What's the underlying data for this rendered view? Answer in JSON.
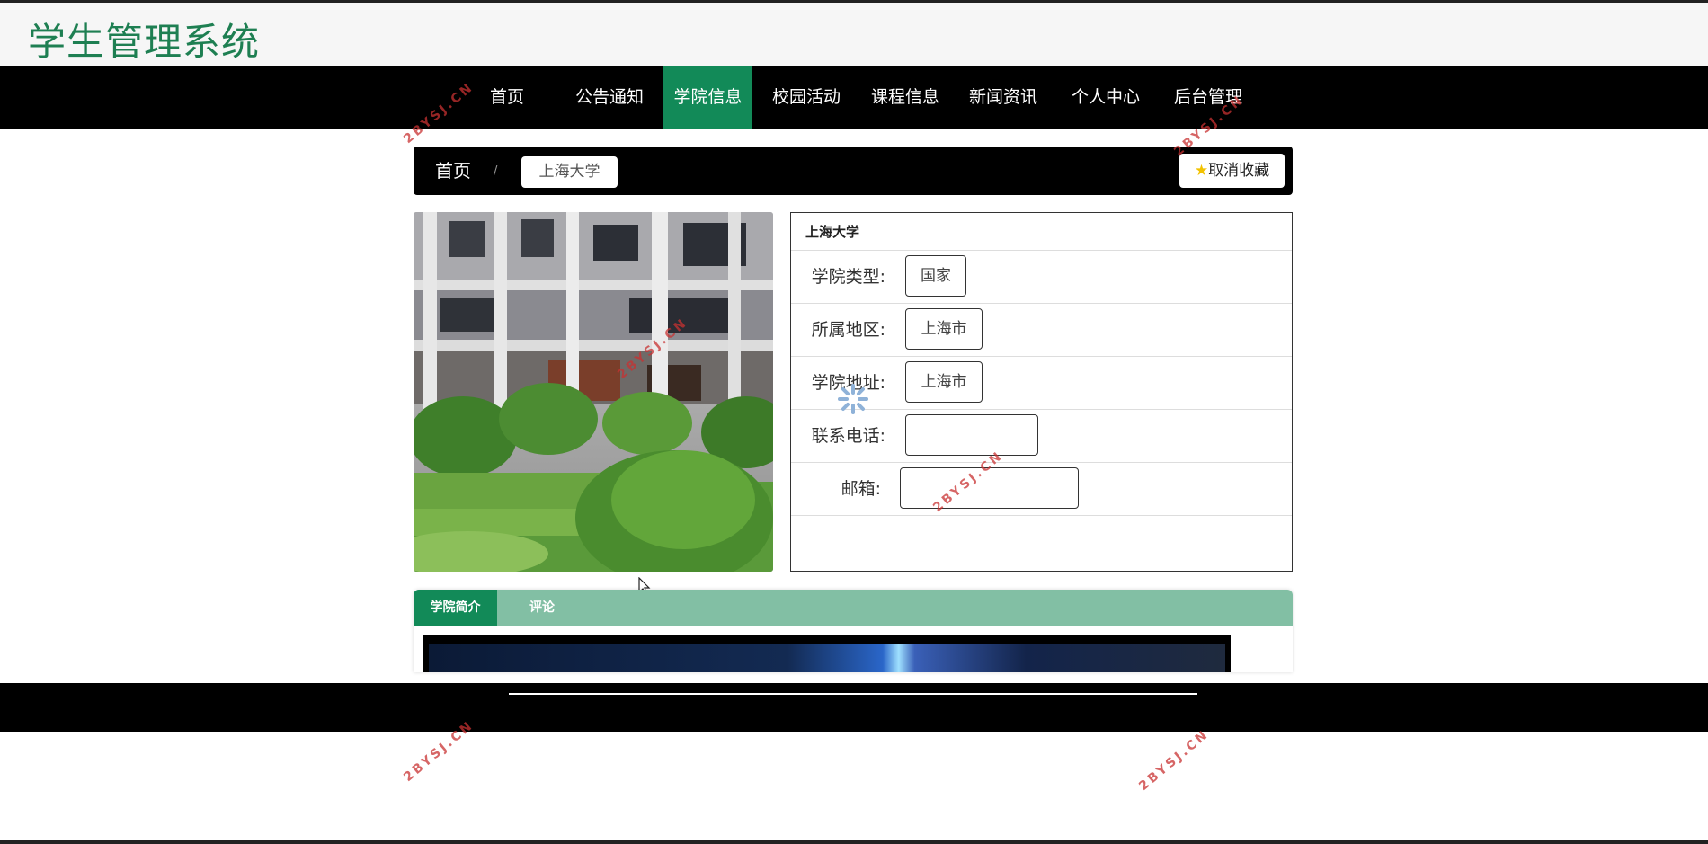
{
  "header": {
    "site_title": "学生管理系统"
  },
  "nav": {
    "items": [
      {
        "label": "首页"
      },
      {
        "label": "公告通知"
      },
      {
        "label": "学院信息"
      },
      {
        "label": "校园活动"
      },
      {
        "label": "课程信息"
      },
      {
        "label": "新闻资讯"
      },
      {
        "label": "个人中心"
      },
      {
        "label": "后台管理"
      }
    ],
    "active_index": 2
  },
  "breadcrumb": {
    "home": "首页",
    "separator": "/",
    "current": "上海大学"
  },
  "favorite_button": {
    "label": "取消收藏",
    "icon": "star-icon"
  },
  "college": {
    "name": "上海大学",
    "fields": [
      {
        "label": "学院类型:",
        "value": "国家"
      },
      {
        "label": "所属地区:",
        "value": "上海市"
      },
      {
        "label": "学院地址:",
        "value": "上海市"
      },
      {
        "label": "联系电话:",
        "value": ""
      },
      {
        "label": "邮箱:",
        "value": ""
      }
    ]
  },
  "tabs": [
    {
      "label": "学院简介"
    },
    {
      "label": "评论"
    }
  ],
  "active_tab": 0,
  "watermark_text": "2BYSJ.CN",
  "colors": {
    "brand_green": "#128a58",
    "title_green": "#1e7f52",
    "tab_strip": "#82bfa4"
  }
}
